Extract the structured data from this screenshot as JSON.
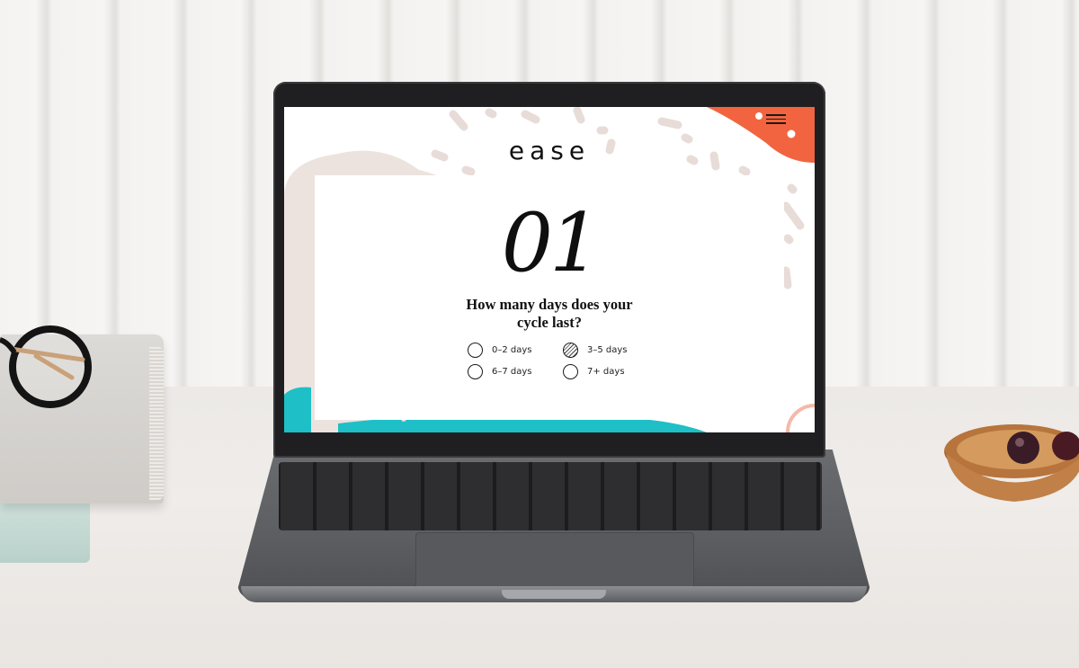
{
  "app": {
    "logo": "ease",
    "menu_icon": "hamburger-menu-icon"
  },
  "question": {
    "number": "01",
    "text_line1": "How many days does your",
    "text_line2": "cycle last?",
    "options": [
      {
        "label": "0–2 days",
        "selected": false
      },
      {
        "label": "3–5 days",
        "selected": true
      },
      {
        "label": "6–7 days",
        "selected": false
      },
      {
        "label": "7+ days",
        "selected": false
      }
    ]
  },
  "colors": {
    "accent_orange": "#f2643f",
    "accent_teal": "#1fbfc7",
    "blob_beige": "#ece3df",
    "confetti": "#e8dcd8"
  }
}
